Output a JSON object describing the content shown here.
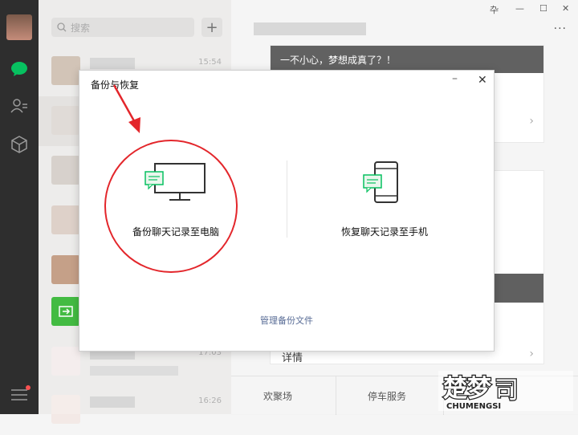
{
  "window": {
    "controls": [
      "卆",
      "—",
      "☐",
      "✕"
    ]
  },
  "search": {
    "placeholder": "搜索"
  },
  "conversations": [
    {
      "time": "15:54",
      "avatar_color": "#c9b7a8"
    },
    {
      "time": "",
      "avatar_color": "#d9d3cf"
    },
    {
      "time": "",
      "avatar_color": "#cfc7c1"
    },
    {
      "time": "",
      "avatar_color": "#d7c7be"
    },
    {
      "time": "",
      "avatar_color": "#b98c6e"
    },
    {
      "time": "",
      "avatar_color": "#1aad19"
    },
    {
      "time": "17:03",
      "avatar_color": "#f2e9ea"
    },
    {
      "time": "16:26",
      "avatar_color": "#f3e9e6"
    }
  ],
  "chat": {
    "banner_text": "一不小心，梦想成真了？！",
    "detail_label": "详情",
    "bottom_tabs": [
      "欢聚场",
      "停车服务"
    ]
  },
  "modal": {
    "title": "备份与恢复",
    "backup_to_pc": "备份聊天记录至电脑",
    "restore_to_phone": "恢复聊天记录至手机",
    "manage_backup": "管理备份文件"
  },
  "watermark": {
    "brand": "楚梦",
    "sub": "CHUMENGSI"
  },
  "colors": {
    "accent": "#07c160",
    "annotation": "#e3262b",
    "link": "#576b95"
  }
}
